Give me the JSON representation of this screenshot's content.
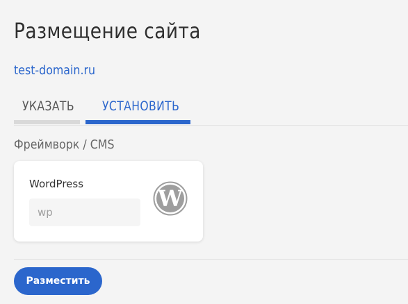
{
  "page": {
    "title": "Размещение сайта",
    "domain": "test-domain.ru"
  },
  "tabs": [
    {
      "label": "УКАЗАТЬ",
      "active": false
    },
    {
      "label": "УСТАНОВИТЬ",
      "active": true
    }
  ],
  "section": {
    "label": "Фреймворк / CMS"
  },
  "framework_card": {
    "name": "WordPress",
    "input_placeholder": "wp",
    "input_value": "",
    "icon": "wordpress-icon"
  },
  "actions": {
    "submit_label": "Разместить"
  },
  "colors": {
    "accent": "#2b66cc",
    "inactive_tab_bar": "#d9d9d9",
    "background": "#f4f4f4",
    "card_background": "#ffffff",
    "logo_gray": "#9e9e9e"
  }
}
